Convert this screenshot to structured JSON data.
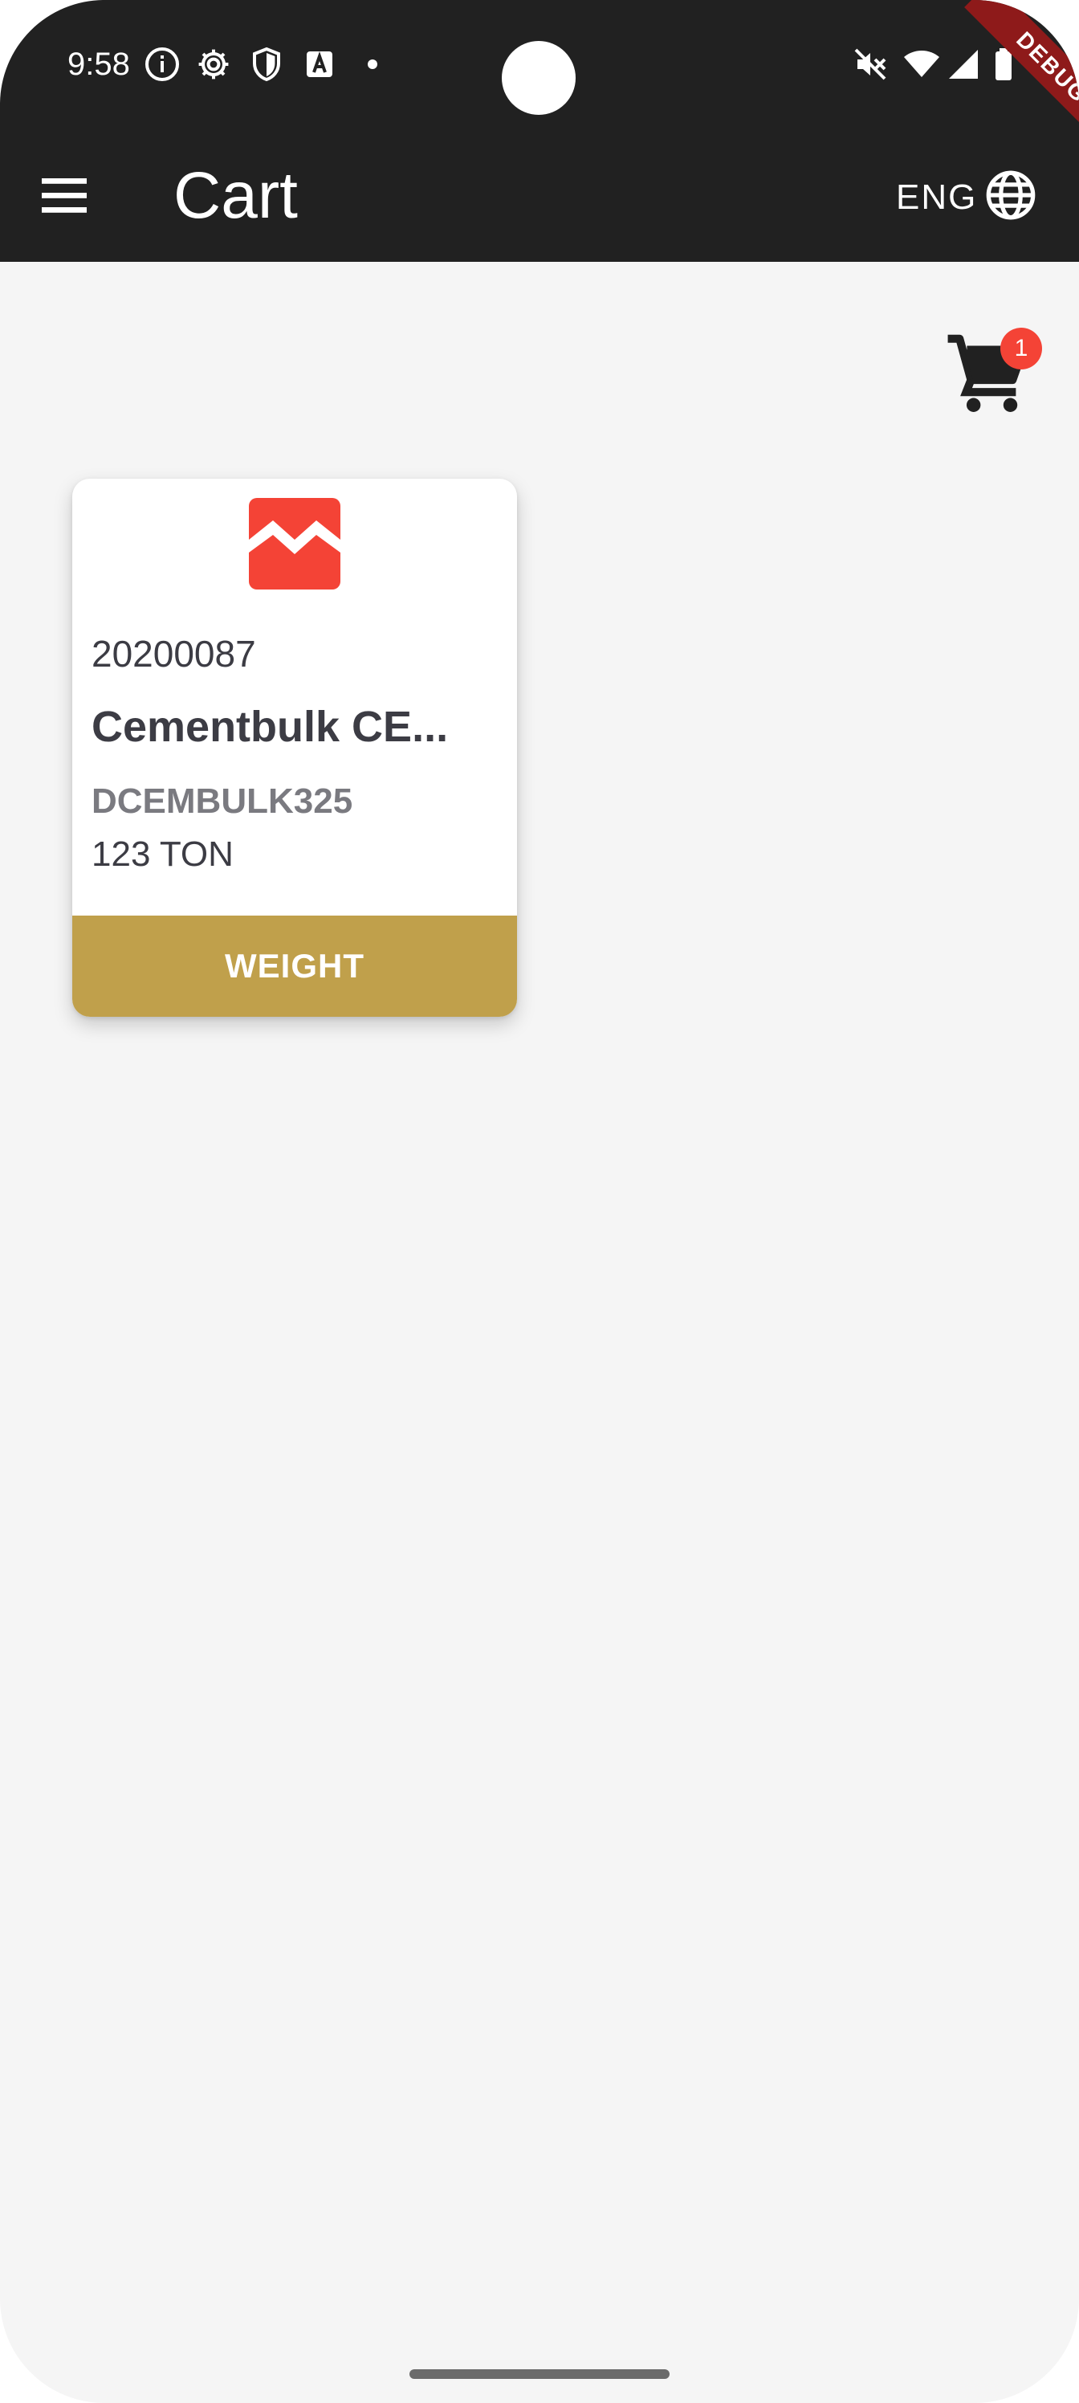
{
  "status_bar": {
    "time": "9:58",
    "icons": [
      "info-icon",
      "gear-icon",
      "shield-icon",
      "text-a-icon",
      "dot-icon",
      "mute-icon",
      "wifi-icon",
      "signal-icon",
      "battery-icon"
    ]
  },
  "debug_banner": "DEBUG",
  "app_bar": {
    "title": "Cart",
    "language": "ENG",
    "menu_icon": "menu-icon",
    "globe_icon": "globe-icon",
    "background": "#212121"
  },
  "cart": {
    "badge_count": "1",
    "badge_color": "#f44336"
  },
  "products": [
    {
      "code": "20200087",
      "name": "Cementbulk CE...",
      "sku": "DCEMBULK325",
      "quantity": "123 TON",
      "action_label": "WEIGHT",
      "action_color": "#c0a04b",
      "logo_color": "#f44336"
    }
  ]
}
